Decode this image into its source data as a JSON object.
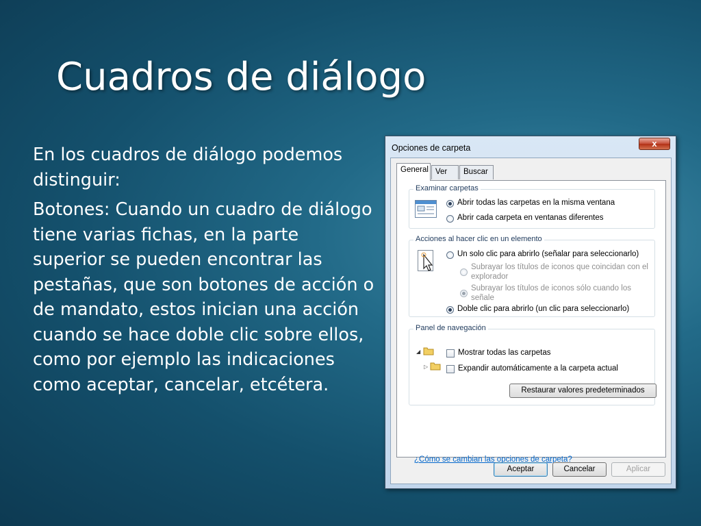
{
  "slide": {
    "title": "Cuadros de diálogo",
    "paragraphs": [
      "En los cuadros de diálogo podemos distinguir:",
      "Botones: Cuando un cuadro de diálogo tiene varias fichas, en la parte superior se pueden encontrar las pestañas, que son botones de acción o de mandato, estos inician una acción cuando se hace doble clic sobre ellos, como por ejemplo las indicaciones como aceptar, cancelar, etcétera."
    ]
  },
  "dialog": {
    "title": "Opciones de carpeta",
    "close_label": "x",
    "tabs": [
      "General",
      "Ver",
      "Buscar"
    ],
    "active_tab": "General",
    "groups": {
      "browse": {
        "label": "Examinar carpetas",
        "options": [
          {
            "label": "Abrir todas las carpetas en la misma ventana",
            "selected": true
          },
          {
            "label": "Abrir cada carpeta en ventanas diferentes",
            "selected": false
          }
        ]
      },
      "click": {
        "label": "Acciones al hacer clic en un elemento",
        "options": [
          {
            "label": "Un solo clic para abrirlo (señalar para seleccionarlo)",
            "selected": false
          },
          {
            "label": "Subrayar los títulos de iconos que coincidan con el explorador",
            "selected": false,
            "disabled": true
          },
          {
            "label": "Subrayar los títulos de iconos sólo cuando los señale",
            "selected": true,
            "disabled": true
          },
          {
            "label": "Doble clic para abrirlo (un clic para seleccionarlo)",
            "selected": true
          }
        ]
      },
      "nav": {
        "label": "Panel de navegación",
        "options": [
          {
            "label": "Mostrar todas las carpetas",
            "checked": false
          },
          {
            "label": "Expandir automáticamente a la carpeta actual",
            "checked": false
          }
        ]
      }
    },
    "restore_label": "Restaurar valores predeterminados",
    "help_link": "¿Cómo se cambian las opciones de carpeta?",
    "buttons": {
      "ok": "Aceptar",
      "cancel": "Cancelar",
      "apply": "Aplicar"
    },
    "colors": {
      "link": "#0066cc",
      "close": "#c7513c",
      "title_frame": "#c2d6ec"
    }
  }
}
